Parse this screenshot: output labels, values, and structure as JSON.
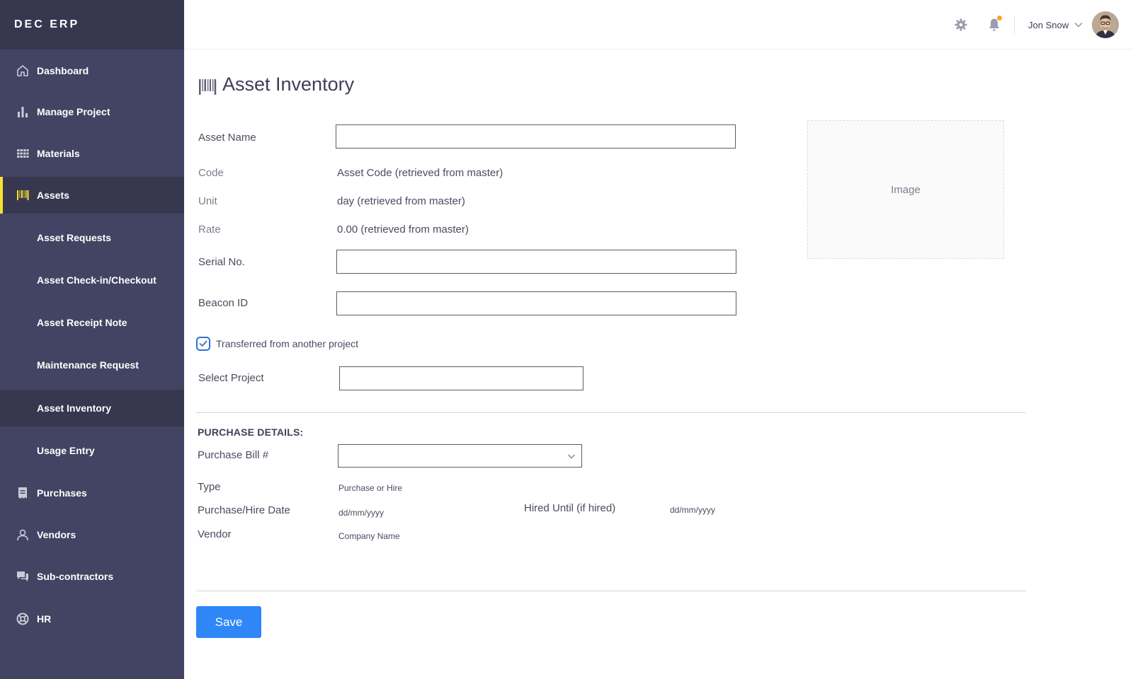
{
  "app": {
    "brand": "DEC ERP"
  },
  "sidebar": {
    "items": [
      {
        "label": "Dashboard",
        "icon": "home-icon"
      },
      {
        "label": "Manage Project",
        "icon": "bar-chart-icon"
      },
      {
        "label": "Materials",
        "icon": "grid-icon"
      },
      {
        "label": "Assets",
        "icon": "barcode-icon",
        "active": true
      },
      {
        "label": "Asset Requests"
      },
      {
        "label": "Asset Check-in/Checkout"
      },
      {
        "label": "Asset Receipt Note"
      },
      {
        "label": "Maintenance Request"
      },
      {
        "label": "Asset Inventory",
        "current": true
      },
      {
        "label": "Usage Entry"
      },
      {
        "label": "Purchases",
        "icon": "receipt-icon"
      },
      {
        "label": "Vendors",
        "icon": "user-icon"
      },
      {
        "label": "Sub-contractors",
        "icon": "chat-icon"
      },
      {
        "label": "HR",
        "icon": "lifebuoy-icon"
      }
    ],
    "accent_color": "#f6e131",
    "background_color": "#434463"
  },
  "header": {
    "user_name": "Jon Snow",
    "notification_dot_color": "#f5a623"
  },
  "page": {
    "title": "Asset Inventory",
    "icon": "barcode-icon"
  },
  "form": {
    "asset_name": {
      "label": "Asset Name",
      "value": ""
    },
    "code": {
      "label": "Code",
      "value": "Asset Code (retrieved from master)"
    },
    "unit": {
      "label": "Unit",
      "value": "day (retrieved from master)"
    },
    "rate": {
      "label": "Rate",
      "value": "0.00 (retrieved from master)"
    },
    "serial_no": {
      "label": "Serial No.",
      "value": ""
    },
    "beacon_id": {
      "label": "Beacon ID",
      "value": ""
    },
    "transferred": {
      "label": "Transferred from another project",
      "checked": true
    },
    "select_project": {
      "label": "Select Project",
      "value": ""
    },
    "image_placeholder": "Image"
  },
  "purchase": {
    "section_title": "PURCHASE DETAILS:",
    "bill": {
      "label": "Purchase Bill #",
      "value": ""
    },
    "type": {
      "label": "Type",
      "value": "Purchase or Hire"
    },
    "date": {
      "label": "Purchase/Hire Date",
      "value": "dd/mm/yyyy"
    },
    "hired_until": {
      "label": "Hired Until (if hired)",
      "value": "dd/mm/yyyy"
    },
    "vendor": {
      "label": "Vendor",
      "value": "Company Name"
    }
  },
  "actions": {
    "save_label": "Save",
    "save_color": "#2f86f6"
  }
}
